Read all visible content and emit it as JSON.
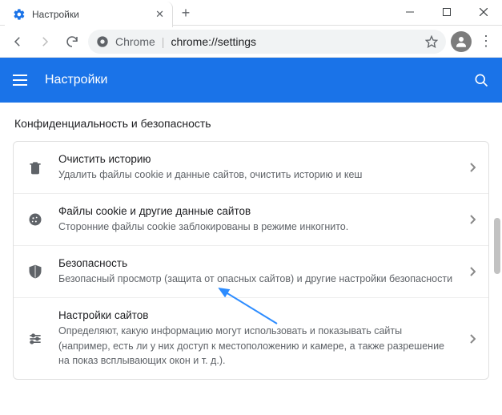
{
  "window": {
    "tab_title": "Настройки"
  },
  "addressbar": {
    "scheme": "Chrome",
    "path": "chrome://settings"
  },
  "header": {
    "title": "Настройки"
  },
  "section": {
    "title": "Конфиденциальность и безопасность"
  },
  "rows": [
    {
      "title": "Очистить историю",
      "sub": "Удалить файлы cookie и данные сайтов, очистить историю и кеш"
    },
    {
      "title": "Файлы cookie и другие данные сайтов",
      "sub": "Сторонние файлы cookie заблокированы в режиме инкогнито."
    },
    {
      "title": "Безопасность",
      "sub": "Безопасный просмотр (защита от опасных сайтов) и другие настройки безопасности"
    },
    {
      "title": "Настройки сайтов",
      "sub": "Определяют, какую информацию могут использовать и показывать сайты (например, есть ли у них доступ к местоположению и камере, а также разрешение на показ всплывающих окон и т. д.)."
    }
  ]
}
